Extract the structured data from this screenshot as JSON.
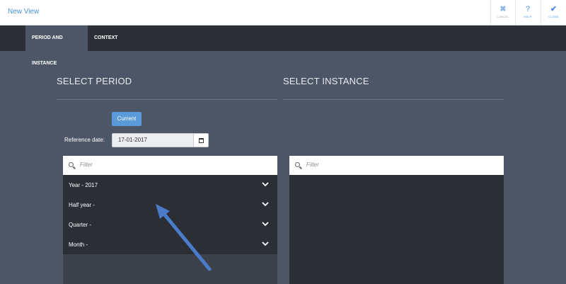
{
  "window": {
    "title": "New View"
  },
  "toolbar": {
    "cancel": {
      "label": "CANCEL",
      "icon": "x-icon"
    },
    "help": {
      "label": "HELP",
      "icon": "question-icon"
    },
    "close": {
      "label": "CLOSE",
      "icon": "check-icon"
    }
  },
  "tabs": [
    {
      "label": "PERIOD AND INSTANCE",
      "active": true
    },
    {
      "label": "CONTEXT",
      "active": false
    }
  ],
  "period": {
    "heading": "SELECT PERIOD",
    "current_button": "Current",
    "reference_label": "Reference date:",
    "reference_value": "17-01-2017",
    "filter_placeholder": "Filter",
    "items": [
      {
        "label": "Year - 2017"
      },
      {
        "label": "Half year -"
      },
      {
        "label": "Quarter -"
      },
      {
        "label": "Month -"
      }
    ]
  },
  "instance": {
    "heading": "SELECT INSTANCE",
    "filter_placeholder": "Filter"
  },
  "colors": {
    "accent": "#4a90d9",
    "background": "#4d5667",
    "dark": "#2b2e35",
    "arrow": "#4a7cc9"
  }
}
